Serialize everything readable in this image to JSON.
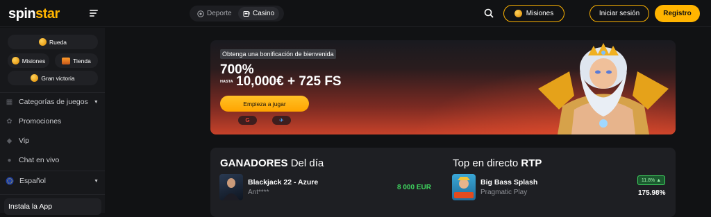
{
  "header": {
    "logo_spin": "spin",
    "logo_star": "star",
    "tabs": [
      {
        "label": "Deporte",
        "icon": "soccer-ball-icon"
      },
      {
        "label": "Casino",
        "icon": "slot-machine-icon"
      }
    ],
    "misiones_label": "Misiones",
    "login_label": "Iniciar sesión",
    "register_label": "Registro",
    "accent": "#ffb400"
  },
  "sidebar": {
    "chips": [
      {
        "label": "Rueda",
        "icon": "wheel-icon"
      },
      {
        "label": "Misiones",
        "icon": "coin-icon"
      },
      {
        "label": "Tienda",
        "icon": "chest-icon"
      },
      {
        "label": "Gran victoria",
        "icon": "trophy-icon"
      }
    ],
    "menu": [
      {
        "label": "Categorías de juegos",
        "icon": "categories-icon"
      },
      {
        "label": "Promociones",
        "icon": "gift-icon"
      },
      {
        "label": "Vip",
        "icon": "diamond-icon"
      },
      {
        "label": "Chat en vivo",
        "icon": "chat-icon"
      }
    ],
    "language": "Español",
    "install_label": "Instala la App"
  },
  "hero": {
    "tag": "Obtenga una bonificación de bienvenida",
    "percent": "700%",
    "hasta": "HASTA",
    "amount": "10,000€ + 725 FS",
    "cta": "Empieza a jugar",
    "social": [
      {
        "label": "G",
        "icon": "google-icon"
      },
      {
        "label": "✈",
        "icon": "telegram-icon"
      }
    ]
  },
  "winners": {
    "title_bold": "GANADORES",
    "title_rest": "Del día",
    "game": "Blackjack 22 - Azure",
    "user": "Ant****",
    "amount": "8 000 EUR"
  },
  "rtp": {
    "title_rest": "Top en directo",
    "title_bold": "RTP",
    "game": "Big Bass Splash",
    "provider": "Pragmatic Play",
    "badge": "11.8%",
    "value": "175.98%"
  }
}
